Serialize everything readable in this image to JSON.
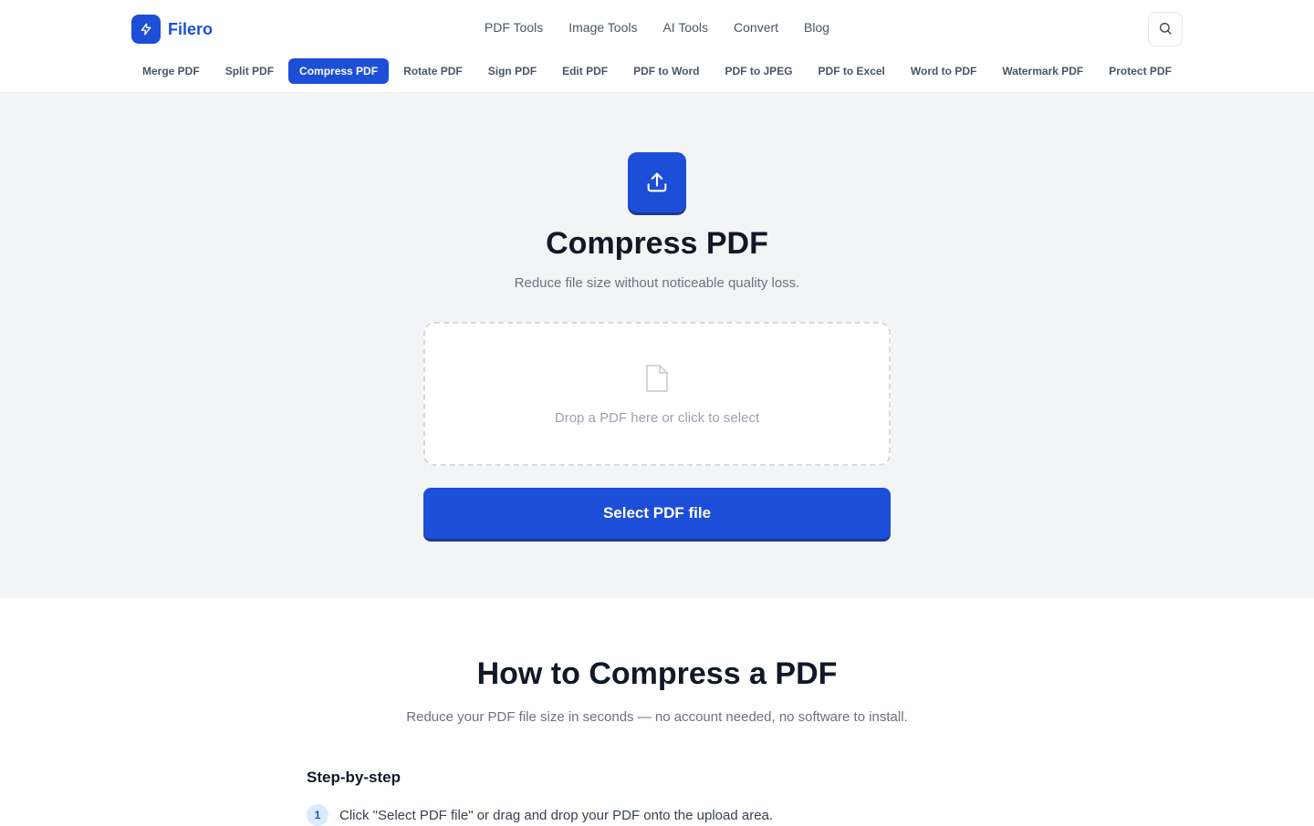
{
  "brand": {
    "name": "Filero",
    "logo_icon": "bolt-icon"
  },
  "topnav": {
    "items": [
      {
        "label": "PDF Tools"
      },
      {
        "label": "Image Tools"
      },
      {
        "label": "AI Tools"
      },
      {
        "label": "Convert"
      },
      {
        "label": "Blog"
      }
    ],
    "search_icon": "search-icon"
  },
  "tools": {
    "active": "Compress PDF",
    "items": [
      {
        "label": "Merge PDF"
      },
      {
        "label": "Split PDF"
      },
      {
        "label": "Compress PDF"
      },
      {
        "label": "Rotate PDF"
      },
      {
        "label": "Sign PDF"
      },
      {
        "label": "Edit PDF"
      },
      {
        "label": "PDF to Word"
      },
      {
        "label": "PDF to JPEG"
      },
      {
        "label": "PDF to Excel"
      },
      {
        "label": "Word to PDF"
      },
      {
        "label": "Watermark PDF"
      },
      {
        "label": "Protect PDF"
      }
    ]
  },
  "hero": {
    "icon": "upload-icon",
    "title": "Compress PDF",
    "subtitle": "Reduce file size without noticeable quality loss.",
    "dropzone_icon": "file-icon",
    "dropzone_text": "Drop a PDF here or click to select",
    "select_button": "Select PDF file"
  },
  "howto": {
    "title": "How to Compress a PDF",
    "subtitle": "Reduce your PDF file size in seconds — no account needed, no software to install.",
    "steps_heading": "Step-by-step",
    "steps": [
      {
        "num": "1",
        "text": "Click \"Select PDF file\" or drag and drop your PDF onto the upload area."
      }
    ]
  },
  "colors": {
    "accent": "#1d4ed8",
    "accent_dark": "#1e3a8a",
    "hero_bg": "#f3f4f6",
    "text_muted": "#6b7280"
  }
}
